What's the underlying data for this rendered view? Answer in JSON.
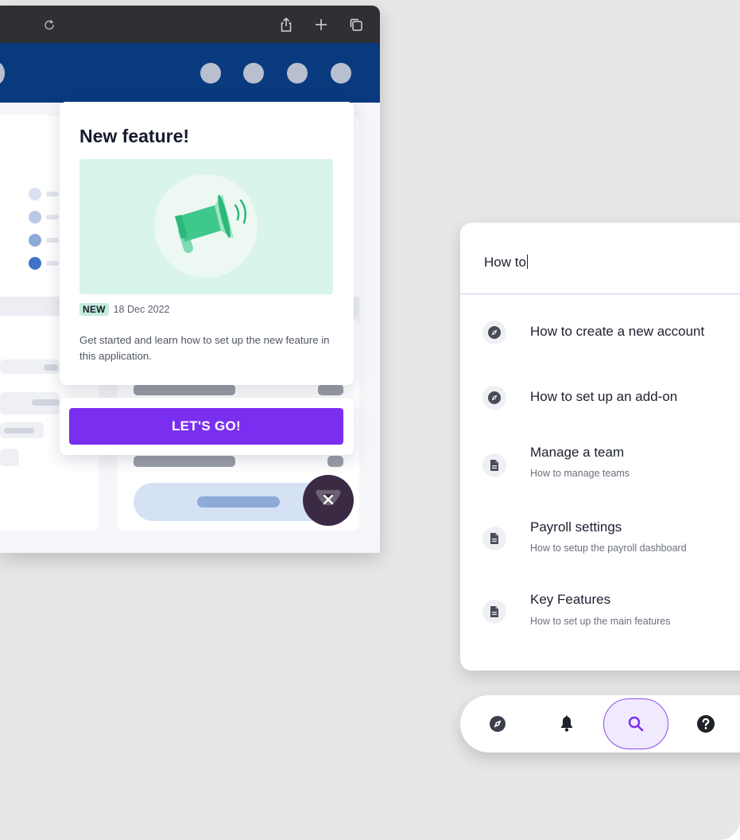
{
  "popup": {
    "title": "New feature!",
    "badge": "NEW",
    "date": "18 Dec 2022",
    "description": "Get started and learn how to set up the new feature in this application.",
    "cta_label": "LET'S GO!",
    "illustration_icon": "megaphone-icon",
    "close_icon": "close-icon"
  },
  "browser": {
    "toolbar_icons": [
      "reload-icon",
      "share-icon",
      "new-tab-icon",
      "tabs-icon"
    ]
  },
  "search": {
    "query": "How to",
    "results": [
      {
        "icon": "compass-icon",
        "title": "How to create a new account",
        "subtitle": ""
      },
      {
        "icon": "compass-icon",
        "title": "How to set up an add-on",
        "subtitle": ""
      },
      {
        "icon": "document-icon",
        "title": "Manage a team",
        "subtitle": "How to manage teams"
      },
      {
        "icon": "document-icon",
        "title": "Payroll settings",
        "subtitle": "How to setup the payroll dashboard"
      },
      {
        "icon": "document-icon",
        "title": "Key Features",
        "subtitle": "How to set up the main features"
      }
    ]
  },
  "nav": {
    "items": [
      "compass-icon",
      "bell-icon",
      "search-icon",
      "help-icon"
    ],
    "active": "search-icon"
  },
  "colors": {
    "background": "#e8e7e5",
    "header": "#0a3a7e",
    "accent": "#7a2ff0",
    "badge": "#c5ebdb",
    "illustration_bg": "#d9f4e8"
  }
}
